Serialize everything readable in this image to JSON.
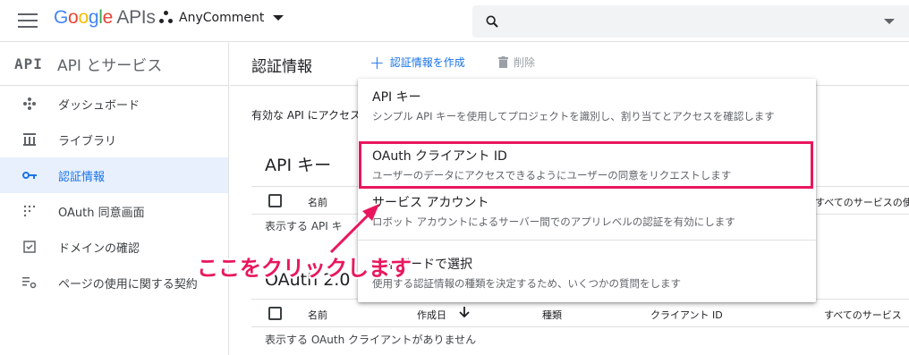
{
  "header": {
    "logo_google": "Google",
    "logo_apis": "APIs",
    "project_name": "AnyComment"
  },
  "sidebar": {
    "badge": "API",
    "title": "API とサービス",
    "items": [
      {
        "label": "ダッシュボード",
        "icon": "dashboard-icon"
      },
      {
        "label": "ライブラリ",
        "icon": "library-icon"
      },
      {
        "label": "認証情報",
        "icon": "key-icon",
        "active": true
      },
      {
        "label": "OAuth 同意画面",
        "icon": "consent-screen-icon"
      },
      {
        "label": "ドメインの確認",
        "icon": "domain-check-icon"
      },
      {
        "label": "ページの使用に関する契約",
        "icon": "settings-icon"
      }
    ]
  },
  "main": {
    "page_title": "認証情報",
    "create_label": "認証情報を作成",
    "delete_label": "削除",
    "intro": "有効な API にアクセス",
    "api_keys": {
      "title": "API キー",
      "col_name": "名前",
      "col_services": "すべてのサービスの使用",
      "empty": "表示する API キ"
    },
    "oauth": {
      "title_partial": "OAuth 2.0 ク",
      "col_name": "名前",
      "col_created": "作成日",
      "col_type": "種類",
      "col_client_id": "クライアント ID",
      "col_services": "すべてのサービス",
      "empty": "表示する OAuth クライアントがありません"
    }
  },
  "dropdown": {
    "items": [
      {
        "title": "API キー",
        "desc": "シンプル API キーを使用してプロジェクトを識別し、割り当てとアクセスを確認します"
      },
      {
        "title": "OAuth クライアント ID",
        "desc": "ユーザーのデータにアクセスできるようにユーザーの同意をリクエストします"
      },
      {
        "title": "サービス アカウント",
        "desc": "ロボット アカウントによるサーバー間でのアプリレベルの認証を有効にします"
      },
      {
        "title": "ウィザードで選択",
        "desc": "使用する認証情報の種類を決定するため、いくつかの質問をします"
      }
    ]
  },
  "annotation": {
    "text": "ここをクリックします",
    "color": "#e8175d"
  },
  "colors": {
    "accent": "#1a73e8",
    "highlight": "#e8175d"
  }
}
